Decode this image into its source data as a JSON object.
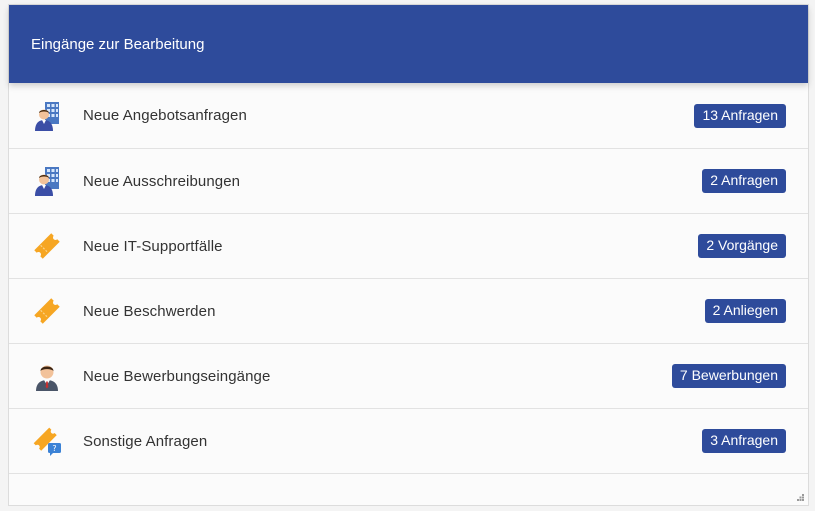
{
  "panel": {
    "title": "Eingänge zur Bearbeitung",
    "items": [
      {
        "label": "Neue Angebotsanfragen",
        "badge": "13 Anfragen",
        "icon": "business-person-icon"
      },
      {
        "label": "Neue Ausschreibungen",
        "badge": "2 Anfragen",
        "icon": "business-person-icon"
      },
      {
        "label": "Neue IT-Supportfälle",
        "badge": "2 Vorgänge",
        "icon": "ticket-icon"
      },
      {
        "label": "Neue Beschwerden",
        "badge": "2 Anliegen",
        "icon": "ticket-icon"
      },
      {
        "label": "Neue Bewerbungseingänge",
        "badge": "7 Bewerbungen",
        "icon": "applicant-icon"
      },
      {
        "label": "Sonstige Anfragen",
        "badge": "3 Anfragen",
        "icon": "ticket-question-icon"
      }
    ]
  },
  "colors": {
    "header": "#2e4b9b",
    "badge": "#2e4b9b",
    "ticket": "#f6a623"
  }
}
